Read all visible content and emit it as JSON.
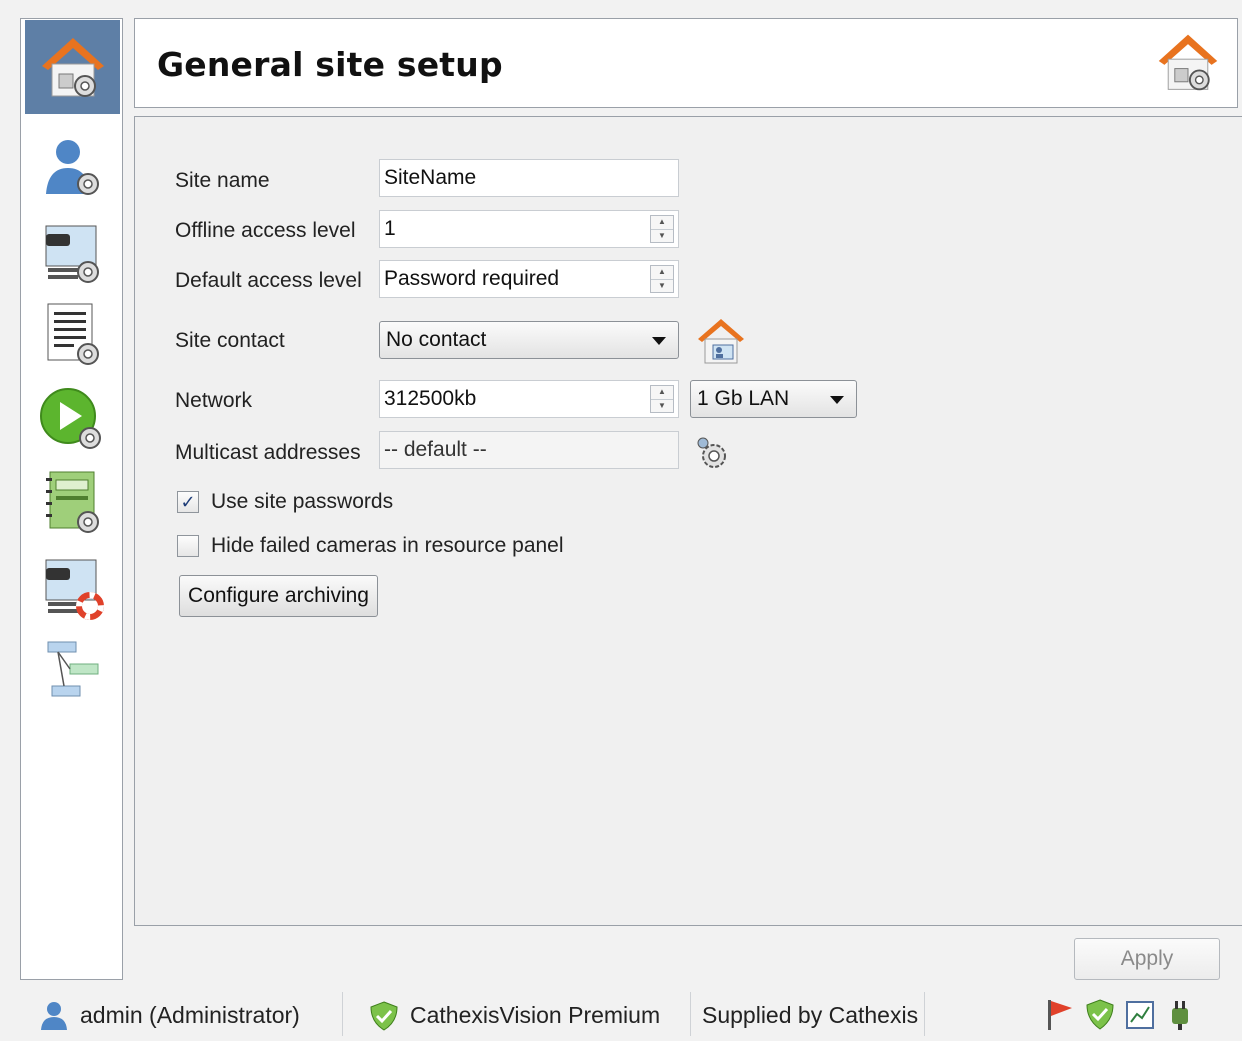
{
  "header": {
    "title": "General site setup"
  },
  "sidebar": {
    "items": [
      {
        "icon": "site-settings-icon",
        "active": true
      },
      {
        "icon": "user-settings-icon"
      },
      {
        "icon": "camera-settings-icon"
      },
      {
        "icon": "list-settings-icon"
      },
      {
        "icon": "play-settings-icon"
      },
      {
        "icon": "notebook-settings-icon"
      },
      {
        "icon": "camera-lifebuoy-icon"
      },
      {
        "icon": "hierarchy-icon"
      }
    ]
  },
  "form": {
    "site_name": {
      "label": "Site name",
      "value": "SiteName"
    },
    "offline_access": {
      "label": "Offline access level",
      "value": "1"
    },
    "default_access": {
      "label": "Default access level",
      "value": "Password required"
    },
    "site_contact": {
      "label": "Site contact",
      "value": "No contact"
    },
    "network": {
      "label": "Network",
      "value": "312500kb",
      "speed": "1 Gb LAN"
    },
    "multicast": {
      "label": "Multicast addresses",
      "value": "-- default --"
    },
    "use_site_passwords": {
      "label": "Use site passwords",
      "checked": true
    },
    "hide_failed_cameras": {
      "label": "Hide failed cameras in resource panel",
      "checked": false
    },
    "configure_archiving": {
      "label": "Configure archiving"
    }
  },
  "apply": {
    "label": "Apply",
    "enabled": false
  },
  "status": {
    "user": "admin (Administrator)",
    "product": "CathexisVision Premium",
    "supplier": "Supplied by Cathexis"
  },
  "colors": {
    "sidebar_active": "#5e7fa6",
    "house_roof": "#e8731f",
    "check": "#1e3d78"
  }
}
